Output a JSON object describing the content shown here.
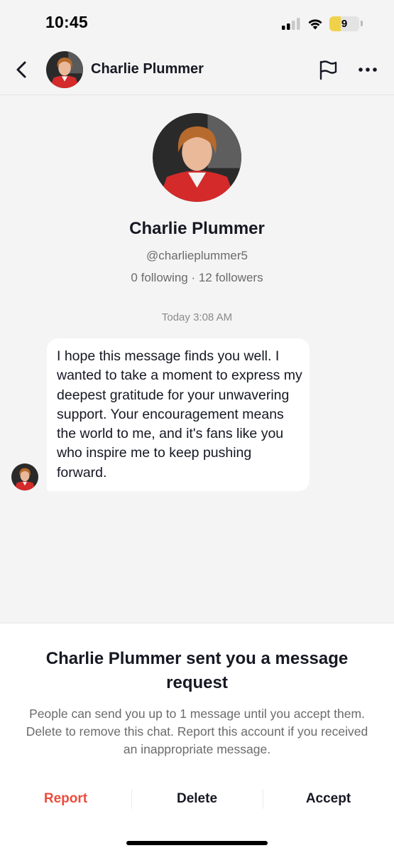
{
  "status_bar": {
    "time": "10:45",
    "battery_level": "9",
    "signal_bars": 2,
    "signal_total": 4
  },
  "header": {
    "back_icon": "chevron-left-icon",
    "name": "Charlie Plummer",
    "flag_icon": "flag-icon",
    "more_icon": "more-horizontal-icon"
  },
  "profile": {
    "name": "Charlie Plummer",
    "handle": "@charlieplummer5",
    "stats": "0 following · 12 followers"
  },
  "conversation": {
    "timestamp": "Today 3:08 AM",
    "messages": [
      {
        "text": "I hope this message finds you well. I wanted to take a moment to express my deepest gratitude for your unwavering support. Your encouragement means the world to me, and it's fans like you who inspire me to keep pushing forward."
      }
    ]
  },
  "request_sheet": {
    "title": "Charlie Plummer sent you a message request",
    "description": "People can send you up to 1 message until you accept them. Delete to remove this chat. Report this account if you received an inappropriate message.",
    "report_label": "Report",
    "delete_label": "Delete",
    "accept_label": "Accept"
  },
  "colors": {
    "report": "#ee4b3c",
    "accent_red": "#d42a2a",
    "background": "#f4f4f4",
    "battery": "#f0d24a"
  }
}
